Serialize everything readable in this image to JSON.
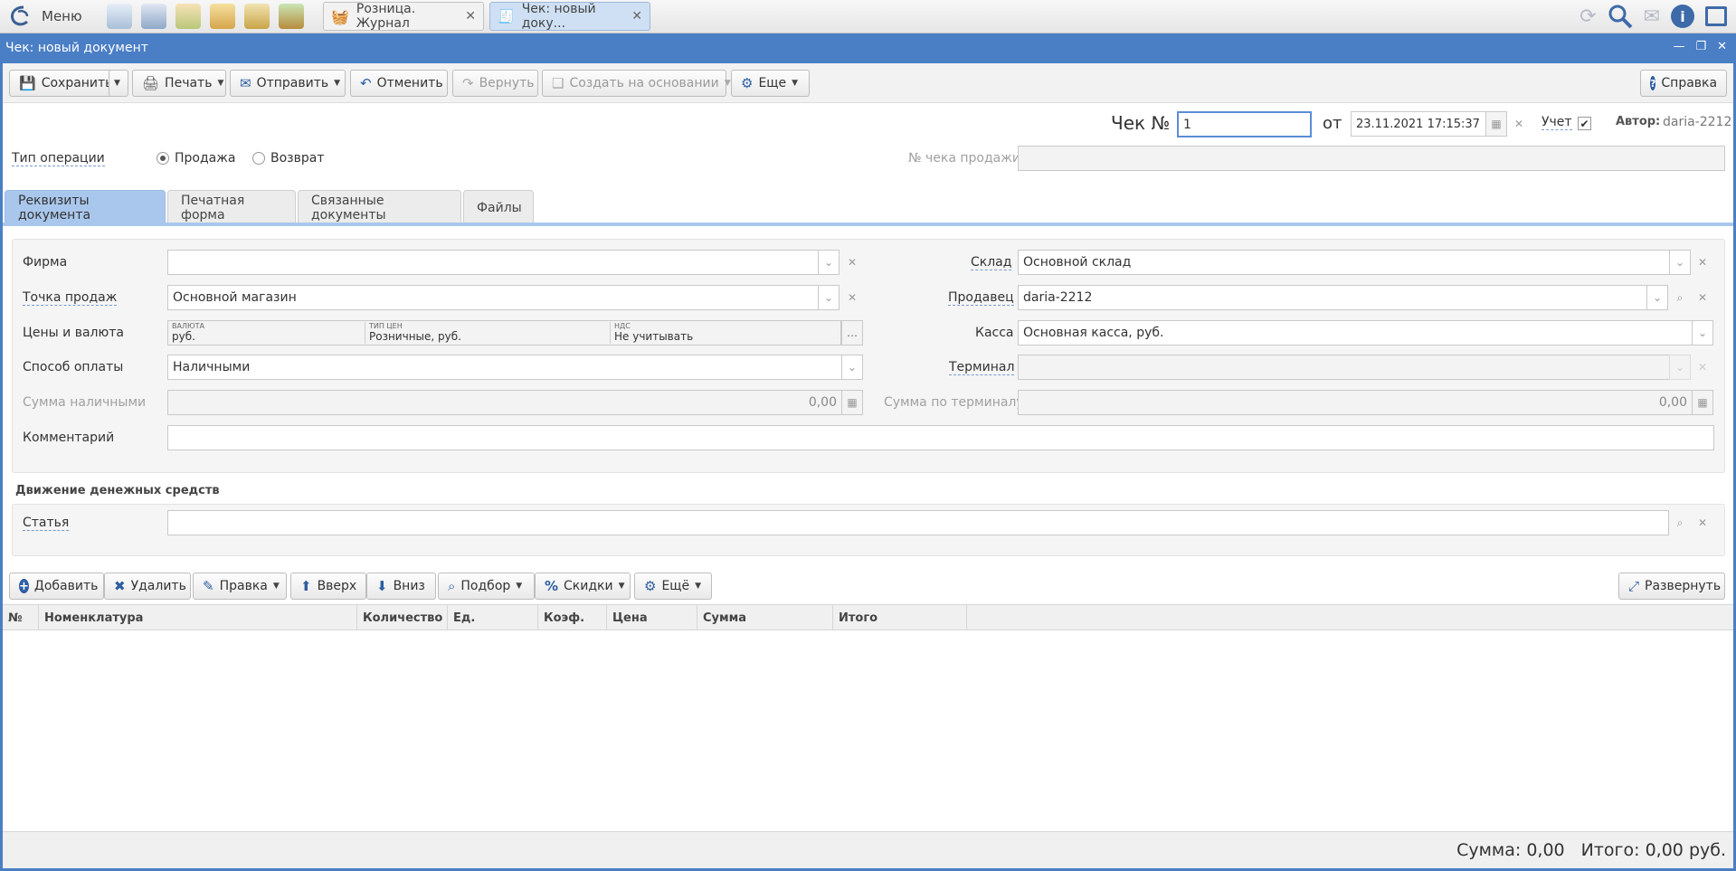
{
  "taskbar": {
    "menu_label": "Меню",
    "tabs": [
      {
        "label": "Розница. Журнал"
      },
      {
        "label": "Чек: новый доку..."
      }
    ]
  },
  "window": {
    "title": "Чек: новый документ"
  },
  "toolbar": {
    "save": "Сохранить",
    "print": "Печать",
    "send": "Отправить",
    "cancel": "Отменить",
    "redo": "Вернуть",
    "create_based": "Создать на основании",
    "more": "Еще",
    "help": "Справка"
  },
  "header": {
    "check_no_label": "Чек №",
    "check_no_value": "1",
    "from_label": "от",
    "date_value": "23.11.2021 17:15:37",
    "account_label": "Учет",
    "account_checked": true,
    "author_label": "Автор:",
    "author_value": "daria-2212",
    "op_type_label": "Тип операции",
    "op_sale": "Продажа",
    "op_return": "Возврат",
    "selected_op": "Продажа",
    "sale_check_label": "№ чека продажи",
    "sale_check_value": ""
  },
  "tabs": [
    {
      "label": "Реквизиты документа",
      "active": true
    },
    {
      "label": "Печатная форма",
      "active": false
    },
    {
      "label": "Связанные документы",
      "active": false
    },
    {
      "label": "Файлы",
      "active": false
    }
  ],
  "form": {
    "firm_label": "Фирма",
    "firm_value": "",
    "pos_label": "Точка продаж",
    "pos_value": "Основной магазин",
    "prices_label": "Цены и валюта",
    "currency_caption": "ВАЛЮТА",
    "currency_value": "руб.",
    "price_type_caption": "ТИП ЦЕН",
    "price_type_value": "Розничные, руб.",
    "vat_caption": "НДС",
    "vat_value": "Не учитывать",
    "payment_label": "Способ оплаты",
    "payment_value": "Наличными",
    "cash_sum_label": "Сумма наличными",
    "cash_sum_value": "0,00",
    "comment_label": "Комментарий",
    "comment_value": "",
    "warehouse_label": "Склад",
    "warehouse_value": "Основной склад",
    "seller_label": "Продавец",
    "seller_value": "daria-2212",
    "cashbox_label": "Касса",
    "cashbox_value": "Основная касса, руб.",
    "terminal_label": "Терминал",
    "terminal_value": "",
    "terminal_sum_label": "Сумма по терминалу",
    "terminal_sum_value": "0,00"
  },
  "cashflow": {
    "title": "Движение денежных средств",
    "article_label": "Статья",
    "article_value": ""
  },
  "table_toolbar": {
    "add": "Добавить",
    "delete": "Удалить",
    "edit": "Правка",
    "up": "Вверх",
    "down": "Вниз",
    "pick": "Подбор",
    "discounts": "Скидки",
    "more": "Ещё",
    "expand": "Развернуть"
  },
  "table": {
    "columns": [
      "№",
      "Номенклатура",
      "Количество",
      "Ед.",
      "Коэф.",
      "Цена",
      "Сумма",
      "Итого"
    ],
    "rows": []
  },
  "footer": {
    "sum_text": "Сумма: 0,00",
    "total_text": "Итого: 0,00 руб."
  },
  "colors": {
    "title_bar": "#4a7ec5",
    "active_tab": "#a9c7ec",
    "active_task_tab": "#cfe0f4"
  }
}
